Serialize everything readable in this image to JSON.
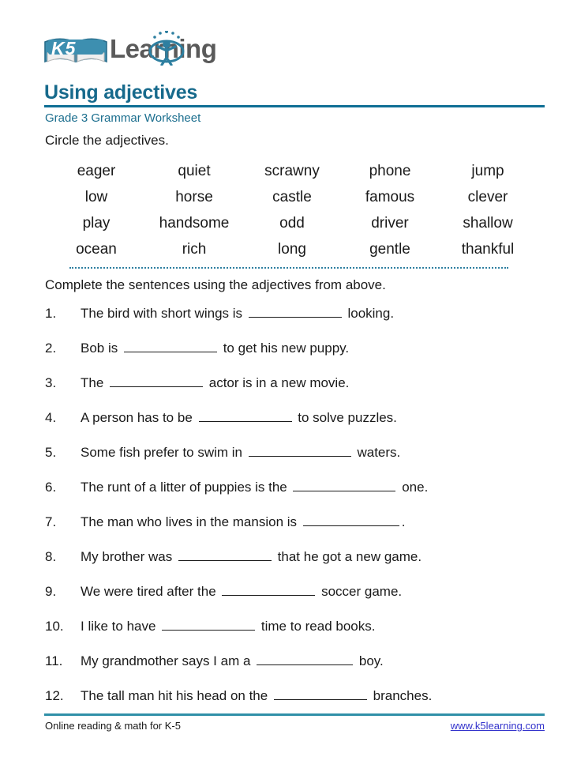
{
  "brand": {
    "logo_k5": "K5",
    "logo_word": "Learning",
    "book_icon": "open-book-icon",
    "person_icon": "person-star-icon",
    "colors": {
      "title_blue": "#176A8C",
      "rule_blue": "#0E6E94",
      "divider_blue": "#2E7FA0",
      "link_blue": "#3333CC",
      "logo_gray": "#5A5A5A"
    }
  },
  "header": {
    "title": "Using adjectives",
    "subtitle": "Grade 3 Grammar Worksheet"
  },
  "instructions": {
    "circle": "Circle the adjectives.",
    "complete": "Complete the sentences using the adjectives from above."
  },
  "word_bank": {
    "rows": [
      [
        "eager",
        "quiet",
        "scrawny",
        "phone",
        "jump"
      ],
      [
        "low",
        "horse",
        "castle",
        "famous",
        "clever"
      ],
      [
        "play",
        "handsome",
        "odd",
        "driver",
        "shallow"
      ],
      [
        "ocean",
        "rich",
        "long",
        "gentle",
        "thankful"
      ]
    ]
  },
  "questions": [
    {
      "num": "1.",
      "before": "The bird with short wings is ",
      "blank_width": 118,
      "after": " looking."
    },
    {
      "num": "2.",
      "before": "Bob is ",
      "blank_width": 118,
      "after": " to get his new puppy."
    },
    {
      "num": "3.",
      "before": "The ",
      "blank_width": 118,
      "after": " actor is in a new movie."
    },
    {
      "num": "4.",
      "before": "A person has to be ",
      "blank_width": 118,
      "after": " to solve puzzles."
    },
    {
      "num": "5.",
      "before": "Some fish prefer to swim in ",
      "blank_width": 130,
      "after": " waters."
    },
    {
      "num": "6.",
      "before": "The runt of a litter of puppies is the ",
      "blank_width": 130,
      "after": " one."
    },
    {
      "num": "7.",
      "before": "The man who lives in the mansion is ",
      "blank_width": 122,
      "after": "."
    },
    {
      "num": "8.",
      "before": "My brother was ",
      "blank_width": 118,
      "after": " that he got a new game."
    },
    {
      "num": "9.",
      "before": "We were tired after the ",
      "blank_width": 118,
      "after": " soccer game."
    },
    {
      "num": "10.",
      "before": "I like to have ",
      "blank_width": 118,
      "after": " time to read books."
    },
    {
      "num": "11.",
      "before": "My grandmother says I am a ",
      "blank_width": 122,
      "after": " boy."
    },
    {
      "num": "12.",
      "before": "The tall man hit his head on the ",
      "blank_width": 118,
      "after": " branches."
    }
  ],
  "footer": {
    "left_text": "Online reading & math for K-5",
    "link_text": "www.k5learning.com"
  }
}
